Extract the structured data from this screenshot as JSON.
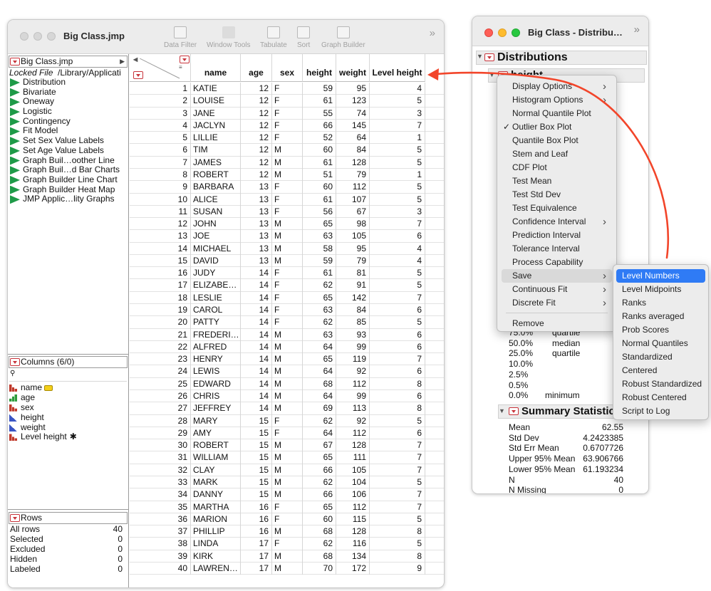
{
  "table_window": {
    "title": "Big Class.jmp",
    "tools": [
      {
        "label": "Data Filter",
        "icon": "data-filter-icon"
      },
      {
        "label": "Window Tools",
        "icon": "cursor-icon"
      },
      {
        "label": "Tabulate",
        "icon": "tabulate-icon"
      },
      {
        "label": "Sort",
        "icon": "sort-icon"
      },
      {
        "label": "Graph Builder",
        "icon": "graph-builder-icon"
      }
    ],
    "overflow": "»",
    "table_panel": {
      "name": "Big Class.jmp",
      "locked_label": "Locked File",
      "locked_path": "/Library/Applicati",
      "scripts": [
        "Distribution",
        "Bivariate",
        "Oneway",
        "Logistic",
        "Contingency",
        "Fit Model",
        "Set Sex Value Labels",
        "Set Age Value Labels",
        "Graph Buil…oother Line",
        "Graph Buil…d Bar Charts",
        "Graph Builder Line Chart",
        "Graph Builder Heat Map",
        "JMP Applic…lity Graphs"
      ]
    },
    "columns_panel": {
      "title": "Columns (6/0)",
      "search_placeholder": "",
      "items": [
        {
          "name": "name",
          "type": "nominal",
          "flag": "key"
        },
        {
          "name": "age",
          "type": "ordinal",
          "flag": ""
        },
        {
          "name": "sex",
          "type": "nominal",
          "flag": ""
        },
        {
          "name": "height",
          "type": "continuous",
          "flag": ""
        },
        {
          "name": "weight",
          "type": "continuous",
          "flag": ""
        },
        {
          "name": "Level height",
          "type": "nominal",
          "flag": "✱"
        }
      ]
    },
    "rows_panel": {
      "title": "Rows",
      "items": [
        {
          "label": "All rows",
          "value": "40"
        },
        {
          "label": "Selected",
          "value": "0"
        },
        {
          "label": "Excluded",
          "value": "0"
        },
        {
          "label": "Hidden",
          "value": "0"
        },
        {
          "label": "Labeled",
          "value": "0"
        }
      ]
    },
    "grid": {
      "headers": [
        "name",
        "age",
        "sex",
        "height",
        "weight",
        "Level height"
      ],
      "rows": [
        [
          "1",
          "KATIE",
          "12",
          "F",
          "59",
          "95",
          "4"
        ],
        [
          "2",
          "LOUISE",
          "12",
          "F",
          "61",
          "123",
          "5"
        ],
        [
          "3",
          "JANE",
          "12",
          "F",
          "55",
          "74",
          "3"
        ],
        [
          "4",
          "JACLYN",
          "12",
          "F",
          "66",
          "145",
          "7"
        ],
        [
          "5",
          "LILLIE",
          "12",
          "F",
          "52",
          "64",
          "1"
        ],
        [
          "6",
          "TIM",
          "12",
          "M",
          "60",
          "84",
          "5"
        ],
        [
          "7",
          "JAMES",
          "12",
          "M",
          "61",
          "128",
          "5"
        ],
        [
          "8",
          "ROBERT",
          "12",
          "M",
          "51",
          "79",
          "1"
        ],
        [
          "9",
          "BARBARA",
          "13",
          "F",
          "60",
          "112",
          "5"
        ],
        [
          "10",
          "ALICE",
          "13",
          "F",
          "61",
          "107",
          "5"
        ],
        [
          "11",
          "SUSAN",
          "13",
          "F",
          "56",
          "67",
          "3"
        ],
        [
          "12",
          "JOHN",
          "13",
          "M",
          "65",
          "98",
          "7"
        ],
        [
          "13",
          "JOE",
          "13",
          "M",
          "63",
          "105",
          "6"
        ],
        [
          "14",
          "MICHAEL",
          "13",
          "M",
          "58",
          "95",
          "4"
        ],
        [
          "15",
          "DAVID",
          "13",
          "M",
          "59",
          "79",
          "4"
        ],
        [
          "16",
          "JUDY",
          "14",
          "F",
          "61",
          "81",
          "5"
        ],
        [
          "17",
          "ELIZABE…",
          "14",
          "F",
          "62",
          "91",
          "5"
        ],
        [
          "18",
          "LESLIE",
          "14",
          "F",
          "65",
          "142",
          "7"
        ],
        [
          "19",
          "CAROL",
          "14",
          "F",
          "63",
          "84",
          "6"
        ],
        [
          "20",
          "PATTY",
          "14",
          "F",
          "62",
          "85",
          "5"
        ],
        [
          "21",
          "FREDERI…",
          "14",
          "M",
          "63",
          "93",
          "6"
        ],
        [
          "22",
          "ALFRED",
          "14",
          "M",
          "64",
          "99",
          "6"
        ],
        [
          "23",
          "HENRY",
          "14",
          "M",
          "65",
          "119",
          "7"
        ],
        [
          "24",
          "LEWIS",
          "14",
          "M",
          "64",
          "92",
          "6"
        ],
        [
          "25",
          "EDWARD",
          "14",
          "M",
          "68",
          "112",
          "8"
        ],
        [
          "26",
          "CHRIS",
          "14",
          "M",
          "64",
          "99",
          "6"
        ],
        [
          "27",
          "JEFFREY",
          "14",
          "M",
          "69",
          "113",
          "8"
        ],
        [
          "28",
          "MARY",
          "15",
          "F",
          "62",
          "92",
          "5"
        ],
        [
          "29",
          "AMY",
          "15",
          "F",
          "64",
          "112",
          "6"
        ],
        [
          "30",
          "ROBERT",
          "15",
          "M",
          "67",
          "128",
          "7"
        ],
        [
          "31",
          "WILLIAM",
          "15",
          "M",
          "65",
          "111",
          "7"
        ],
        [
          "32",
          "CLAY",
          "15",
          "M",
          "66",
          "105",
          "7"
        ],
        [
          "33",
          "MARK",
          "15",
          "M",
          "62",
          "104",
          "5"
        ],
        [
          "34",
          "DANNY",
          "15",
          "M",
          "66",
          "106",
          "7"
        ],
        [
          "35",
          "MARTHA",
          "16",
          "F",
          "65",
          "112",
          "7"
        ],
        [
          "36",
          "MARION",
          "16",
          "F",
          "60",
          "115",
          "5"
        ],
        [
          "37",
          "PHILLIP",
          "16",
          "M",
          "68",
          "128",
          "8"
        ],
        [
          "38",
          "LINDA",
          "17",
          "F",
          "62",
          "116",
          "5"
        ],
        [
          "39",
          "KIRK",
          "17",
          "M",
          "68",
          "134",
          "8"
        ],
        [
          "40",
          "LAWREN…",
          "17",
          "M",
          "70",
          "172",
          "9"
        ]
      ]
    }
  },
  "dist_window": {
    "title": "Big Class - Distribu…",
    "overflow": "»",
    "heading": "Distributions",
    "sub_heading": "height",
    "quantiles": [
      {
        "pct": "75.0%",
        "label": "quartile"
      },
      {
        "pct": "50.0%",
        "label": "median"
      },
      {
        "pct": "25.0%",
        "label": "quartile"
      },
      {
        "pct": "10.0%",
        "label": ""
      },
      {
        "pct": "2.5%",
        "label": ""
      },
      {
        "pct": "0.5%",
        "label": ""
      },
      {
        "pct": "0.0%",
        "label": "minimum"
      }
    ],
    "summary": {
      "title": "Summary Statistics",
      "rows": [
        {
          "label": "Mean",
          "value": "62.55"
        },
        {
          "label": "Std Dev",
          "value": "4.2423385"
        },
        {
          "label": "Std Err Mean",
          "value": "0.6707726"
        },
        {
          "label": "Upper 95% Mean",
          "value": "63.906766"
        },
        {
          "label": "Lower 95% Mean",
          "value": "61.193234"
        },
        {
          "label": "N",
          "value": "40"
        },
        {
          "label": "N Missing",
          "value": "0"
        }
      ]
    }
  },
  "context_menu": {
    "items": [
      "Display Options",
      "Histogram Options",
      "Normal Quantile Plot",
      "Outlier Box Plot",
      "Quantile Box Plot",
      "Stem and Leaf",
      "CDF Plot",
      "Test Mean",
      "Test Std Dev",
      "Test Equivalence",
      "Confidence Interval",
      "Prediction Interval",
      "Tolerance Interval",
      "Process Capability",
      "Save",
      "Continuous Fit",
      "Discrete Fit",
      "Remove"
    ],
    "checked": "Outlier Box Plot",
    "selected": "Save",
    "checkmark": "✓",
    "chevron": "›"
  },
  "save_submenu": {
    "items": [
      "Level Numbers",
      "Level Midpoints",
      "Ranks",
      "Ranks averaged",
      "Prob Scores",
      "Normal Quantiles",
      "Standardized",
      "Centered",
      "Robust Standardized",
      "Robust Centered",
      "Script to Log"
    ],
    "highlighted": "Level Numbers"
  },
  "colors": {
    "red_triangle": "#c8343b",
    "script_icon": "#1f9a48",
    "highlight": "#2f7bf5",
    "arrow": "#f2452a"
  }
}
